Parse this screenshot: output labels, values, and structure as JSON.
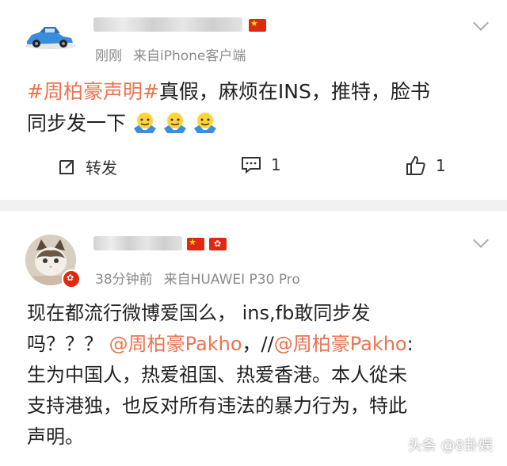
{
  "post1": {
    "meta": {
      "time": "刚刚",
      "source": "来自iPhone客户端"
    },
    "content": {
      "topic": "#周柏豪声明#",
      "line1_rest": "真假，麻烦在INS，推特，脸书",
      "line2": "同步发一下"
    },
    "actions": {
      "repost_label": "转发",
      "comment_count": "1",
      "like_count": "1"
    }
  },
  "post2": {
    "meta": {
      "time": "38分钟前",
      "source": "来自HUAWEI P30 Pro"
    },
    "content": {
      "line1": "现在都流行微博爱国么， ins,fb敢同步发",
      "line2_a": "吗？？？ ",
      "mention1": "@周柏豪Pakho",
      "line2_b": "，//",
      "mention2": "@周柏豪Pakho",
      "line2_c": ":",
      "line3": "生为中国人，热爱祖国、热爱香港。本人從未",
      "line4": "支持港独，也反对所有违法的暴力行为，特此",
      "line5": "声明。"
    }
  },
  "watermark": "头条 @8卦娱",
  "colors": {
    "accent": "#eb7350",
    "meta": "#8a8a8a",
    "background": "#ffffff",
    "divider": "#f1f1f1"
  },
  "icons": [
    "car-avatar-icon",
    "china-flag-icon",
    "hongkong-flag-icon",
    "chevron-down-icon",
    "repost-icon",
    "comment-icon",
    "like-icon",
    "emoji-icon"
  ]
}
